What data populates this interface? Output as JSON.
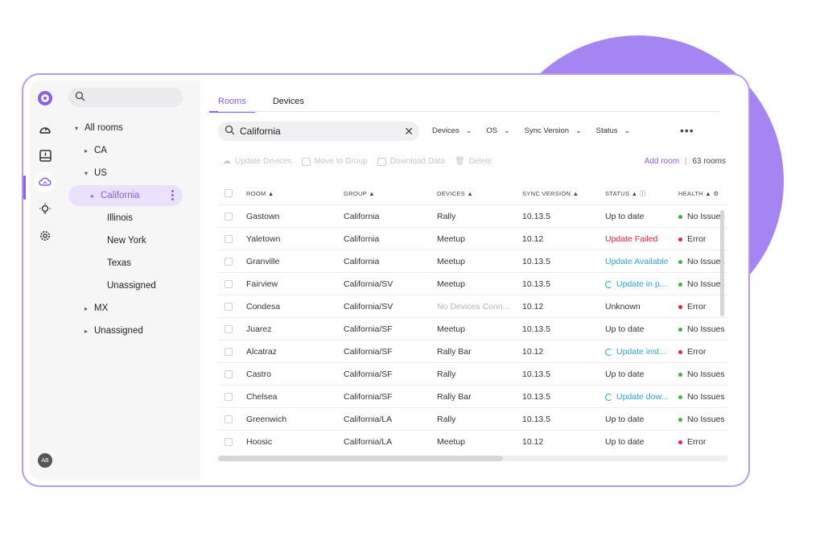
{
  "colors": {
    "accent": "#8a5cf0",
    "error": "#e5243b",
    "ok": "#3bb54a",
    "info": "#2aa4d8",
    "muted": "#b5b5ba"
  },
  "rail": {
    "icons": [
      "logo-icon",
      "dashboard-icon",
      "inbox-icon",
      "cloud-icon",
      "lightbulb-icon",
      "settings-icon"
    ],
    "avatar": "AB"
  },
  "tree": {
    "nodes": [
      {
        "label": "All rooms",
        "caret": "▾"
      },
      {
        "label": "CA",
        "caret": "▸"
      },
      {
        "label": "US",
        "caret": "▾"
      },
      {
        "label": "California",
        "caret": "▸",
        "selected": true
      },
      {
        "label": "Illinois",
        "caret": ""
      },
      {
        "label": "New York",
        "caret": ""
      },
      {
        "label": "Texas",
        "caret": ""
      },
      {
        "label": "Unassigned",
        "caret": ""
      },
      {
        "label": "MX",
        "caret": "▸"
      },
      {
        "label": "Unassigned",
        "caret": "▸"
      }
    ]
  },
  "tabs": [
    {
      "label": "Rooms",
      "active": true
    },
    {
      "label": "Devices",
      "active": false
    }
  ],
  "search": {
    "value": "California"
  },
  "filters": [
    "Devices",
    "OS",
    "Sync Version",
    "Status"
  ],
  "toolbar": {
    "update": "Update Devices",
    "move": "Move to Group",
    "download": "Download Data",
    "delete": "Delete"
  },
  "summary": {
    "add_room": "Add room",
    "separator": "|",
    "count": "63 rooms"
  },
  "table": {
    "headers": {
      "room": "ROOM ▲",
      "group": "GROUP ▲",
      "devices": "DEVICES ▲",
      "sync": "SYNC VERSION ▲",
      "status": "STATUS ▲ ⓘ",
      "health": "HEALTH ▲ ⚙"
    },
    "rows": [
      {
        "room": "Gastown",
        "group": "California",
        "devices": "Rally",
        "sync": "10.13.5",
        "status": "Up to date",
        "status_kind": "normal",
        "health": "No Issues",
        "health_kind": "ok"
      },
      {
        "room": "Yaletown",
        "group": "California",
        "devices": "Meetup",
        "sync": "10.12",
        "status": "Update Failed",
        "status_kind": "error",
        "health": "Error",
        "health_kind": "error"
      },
      {
        "room": "Granville",
        "group": "California",
        "devices": "Meetup",
        "sync": "10.13.5",
        "status": "Update Available",
        "status_kind": "info",
        "health": "No Issues",
        "health_kind": "ok"
      },
      {
        "room": "Fairview",
        "group": "California/SV",
        "devices": "Meetup",
        "sync": "10.13.5",
        "status": "Update in p...",
        "status_kind": "progress",
        "health": "No Issues",
        "health_kind": "ok"
      },
      {
        "room": "Condesa",
        "group": "California/SV",
        "devices": "No Devices Conn...",
        "devices_kind": "muted",
        "sync": "10.12",
        "status": "Unknown",
        "status_kind": "normal",
        "health": "Error",
        "health_kind": "error"
      },
      {
        "room": "Juarez",
        "group": "California/SF",
        "devices": "Meetup",
        "sync": "10.13.5",
        "status": "Up to date",
        "status_kind": "normal",
        "health": "No Issues",
        "health_kind": "ok"
      },
      {
        "room": "Alcatraz",
        "group": "California/SF",
        "devices": "Rally Bar",
        "sync": "10.12",
        "status": "Update inst...",
        "status_kind": "progress",
        "health": "Error",
        "health_kind": "error"
      },
      {
        "room": "Castro",
        "group": "California/SF",
        "devices": "Rally",
        "sync": "10.13.5",
        "status": "Up to date",
        "status_kind": "normal",
        "health": "No Issues",
        "health_kind": "ok"
      },
      {
        "room": "Chelsea",
        "group": "California/SF",
        "devices": "Rally Bar",
        "sync": "10.13.5",
        "status": "Update dow...",
        "status_kind": "progress",
        "health": "No Issues",
        "health_kind": "ok"
      },
      {
        "room": "Greenwich",
        "group": "California/LA",
        "devices": "Rally",
        "sync": "10.13.5",
        "status": "Up to date",
        "status_kind": "normal",
        "health": "No Issues",
        "health_kind": "ok"
      },
      {
        "room": "Hoosic",
        "group": "California/LA",
        "devices": "Meetup",
        "sync": "10.12",
        "status": "Up to date",
        "status_kind": "normal",
        "health": "Error",
        "health_kind": "error"
      }
    ]
  }
}
